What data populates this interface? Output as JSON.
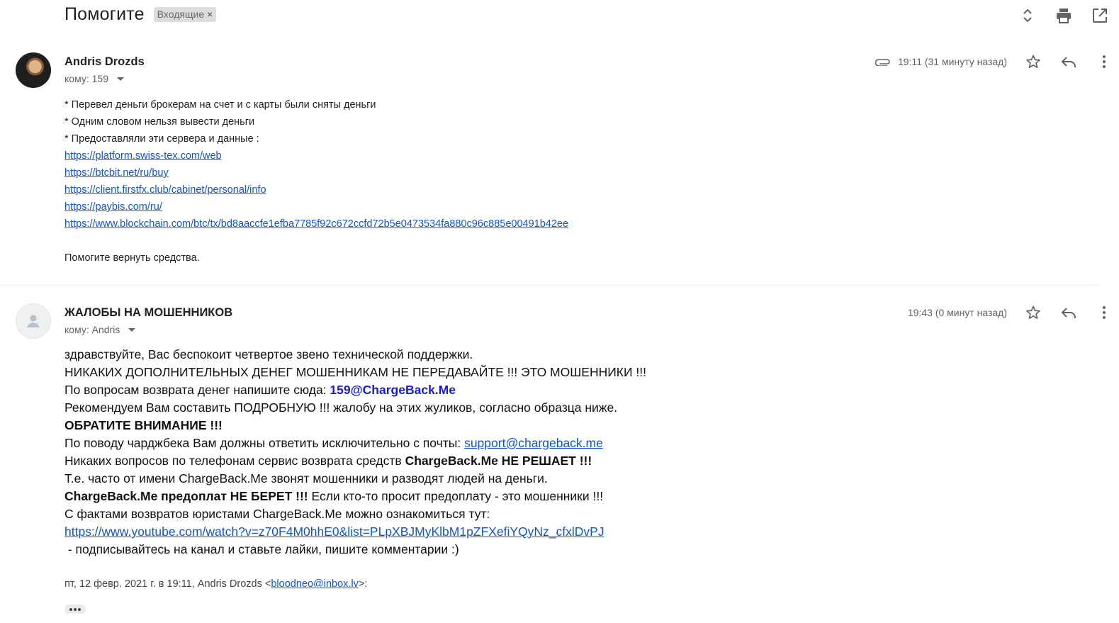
{
  "thread": {
    "subject": "Помогите",
    "label": "Входящие",
    "label_remove": "×"
  },
  "top_actions": [
    "expand-collapse-icon",
    "print-icon",
    "open-new-window-icon"
  ],
  "message1": {
    "sender": "Andris Drozds",
    "to": "кому: 159",
    "time": "19:11 (31 минуту назад)",
    "has_attachment": true,
    "lines": [
      "* Перевел деньги брокерам на счет и с карты были сняты деньги",
      "* Одним словом нельзя вывести деньги",
      "* Предоставляли эти сервера и данные :"
    ],
    "links": [
      "https://platform.swiss-tex.com/web",
      "https://btcbit.net/ru/buy",
      "https://client.firstfx.club/cabinet/personal/info",
      "https://paybis.com/ru/",
      "https://www.blockchain.com/btc/tx/bd8aaccfe1efba7785f92c672ccfd72b5e0473534fa880c96c885e00491b42ee"
    ],
    "closing": "Помогите вернуть средства."
  },
  "message2": {
    "sender": "ЖАЛОБЫ НА МОШЕННИКОВ",
    "to": "кому: Andris",
    "time": "19:43 (0 минут назад)",
    "line1": "здравствуйте, Вас беспокоит четвертое звено технической поддержки.",
    "line2": "НИКАКИХ ДОПОЛНИТЕЛЬНЫХ ДЕНЕГ МОШЕННИКАМ НЕ ПЕРЕДАВАЙТЕ !!! ЭТО МОШЕННИКИ !!!",
    "line3_prefix": "По вопросам возврата денег напишите сюда: ",
    "line3_email": "159@ChargeBack.Me",
    "line4": "Рекомендуем Вам составить ПОДРОБНУЮ !!! жалобу на этих жуликов, согласно образца ниже.",
    "line5": "ОБРАТИТЕ ВНИМАНИЕ !!!",
    "line6_prefix": "По поводу чарджбека Вам должны ответить исключительно с почты: ",
    "line6_email": "support@chargeback.me",
    "line7_prefix": "Никаких вопросов по телефонам сервис возврата средств ",
    "line7_bold": "ChargeBack.Me НЕ РЕШАЕТ !!!",
    "line8": "Т.е. часто от имени ChargeBack.Me звонят мошенники и разводят людей на деньги.",
    "line9_bold": "ChargeBack.Me предоплат НЕ БЕРЕТ !!!",
    "line9_rest": " Если кто-то просит предоплату - это мошенники !!!",
    "line10": "С фактами возвратов юристами ChargeBack.Me можно ознакомиться тут:",
    "youtube_link": "https://www.youtube.com/watch?v=z70F4M0hhE0&list=PLpXBJMyKlbM1pZFXefiYQyNz_cfxlDvPJ",
    "line11": " - подписывайтесь на канал и ставьте лайки, пишите комментарии :)"
  },
  "quote": {
    "prefix": "пт, 12 февр. 2021 г. в 19:11, Andris Drozds <",
    "email": "bloodneo@inbox.lv",
    "suffix": ">:"
  }
}
